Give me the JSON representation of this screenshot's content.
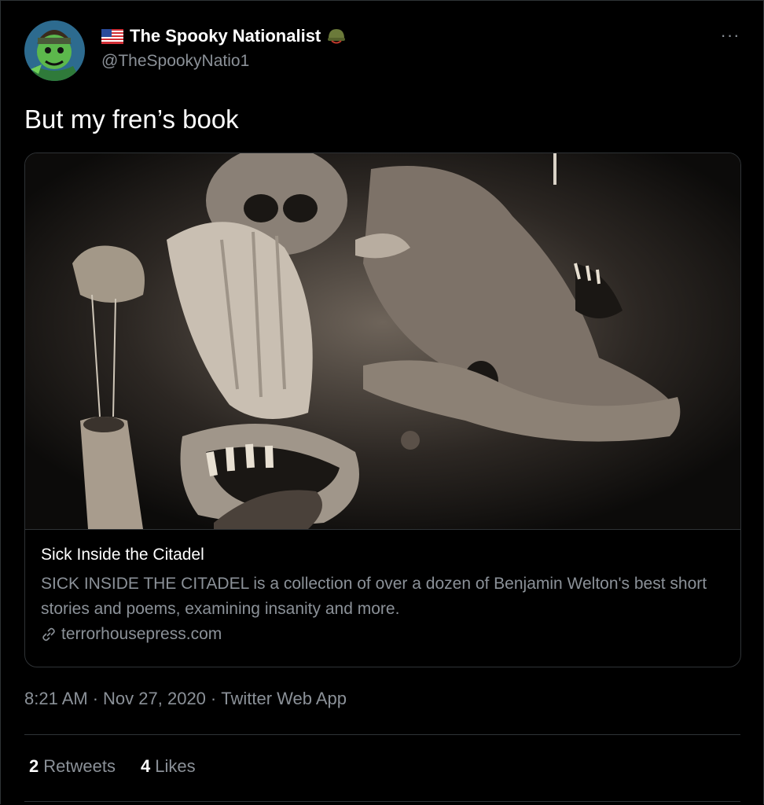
{
  "tweet": {
    "display_name": "The Spooky Nationalist",
    "handle": "@TheSpookyNatio1",
    "more_label": "···",
    "text": "But my fren’s book",
    "badges": [
      "us-flag-icon",
      "army-helmet-icon"
    ]
  },
  "card": {
    "title": "Sick Inside the Citadel",
    "description": "SICK INSIDE THE CITADEL is a collection of over a dozen of Benjamin Welton's best short stories and poems, examining insanity and more.",
    "domain": "terrorhousepress.com",
    "image_alt": "dark sepia illustration of grotesque screaming figures"
  },
  "meta": {
    "time": "8:21 AM",
    "separator": "·",
    "date": "Nov 27, 2020",
    "source": "Twitter Web App"
  },
  "stats": {
    "retweets_count": "2",
    "retweets_label": "Retweets",
    "likes_count": "4",
    "likes_label": "Likes"
  },
  "colors": {
    "background": "#000000",
    "primary_text": "#ffffff",
    "secondary_text": "#8b9198",
    "border": "#2f3336"
  }
}
